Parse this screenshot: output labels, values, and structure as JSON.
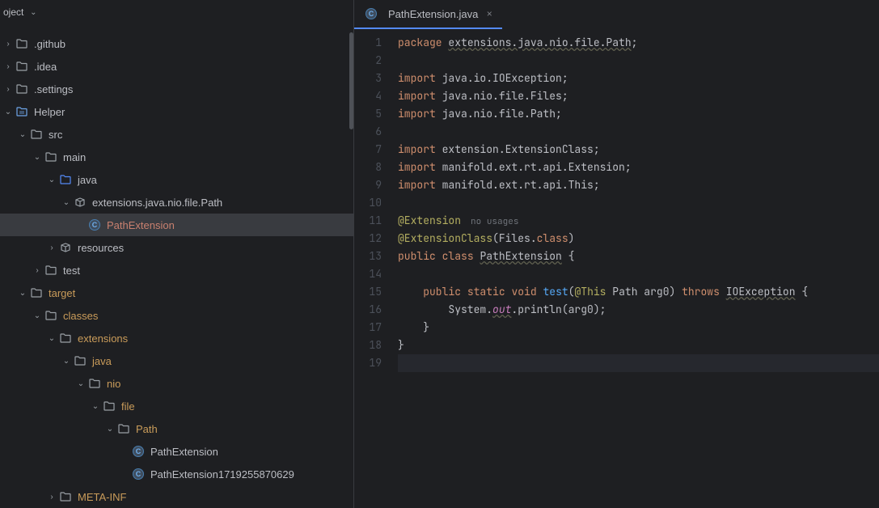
{
  "sidebar": {
    "header": "oject",
    "tree": [
      {
        "label": ".github",
        "depth": 0,
        "expanded": false,
        "icon": "folder",
        "arrow": true
      },
      {
        "label": ".idea",
        "depth": 0,
        "expanded": false,
        "icon": "folder",
        "arrow": true
      },
      {
        "label": ".settings",
        "depth": 0,
        "expanded": false,
        "icon": "folder",
        "arrow": true
      },
      {
        "label": "Helper",
        "depth": 0,
        "expanded": true,
        "icon": "module",
        "arrow": true
      },
      {
        "label": "src",
        "depth": 1,
        "expanded": true,
        "icon": "folder",
        "arrow": true
      },
      {
        "label": "main",
        "depth": 2,
        "expanded": true,
        "icon": "folder",
        "arrow": true
      },
      {
        "label": "java",
        "depth": 3,
        "expanded": true,
        "icon": "java-folder",
        "arrow": true
      },
      {
        "label": "extensions.java.nio.file.Path",
        "depth": 4,
        "expanded": true,
        "icon": "package",
        "arrow": true
      },
      {
        "label": "PathExtension",
        "depth": 5,
        "expanded": false,
        "icon": "class",
        "selected": true,
        "selectedFile": true,
        "arrow": false
      },
      {
        "label": "resources",
        "depth": 3,
        "expanded": false,
        "icon": "package",
        "arrow": true
      },
      {
        "label": "test",
        "depth": 2,
        "expanded": false,
        "icon": "folder",
        "arrow": true
      },
      {
        "label": "target",
        "depth": 1,
        "expanded": true,
        "icon": "target-folder",
        "arrow": true,
        "target": true
      },
      {
        "label": "classes",
        "depth": 2,
        "expanded": true,
        "icon": "target-folder",
        "arrow": true,
        "target": true
      },
      {
        "label": "extensions",
        "depth": 3,
        "expanded": true,
        "icon": "target-folder",
        "arrow": true,
        "target": true
      },
      {
        "label": "java",
        "depth": 4,
        "expanded": true,
        "icon": "target-folder",
        "arrow": true,
        "target": true
      },
      {
        "label": "nio",
        "depth": 5,
        "expanded": true,
        "icon": "target-folder",
        "arrow": true,
        "target": true
      },
      {
        "label": "file",
        "depth": 6,
        "expanded": true,
        "icon": "target-folder",
        "arrow": true,
        "target": true
      },
      {
        "label": "Path",
        "depth": 7,
        "expanded": true,
        "icon": "target-folder",
        "arrow": true,
        "target": true
      },
      {
        "label": "PathExtension",
        "depth": 8,
        "expanded": false,
        "icon": "class",
        "arrow": false
      },
      {
        "label": "PathExtension1719255870629",
        "depth": 8,
        "expanded": false,
        "icon": "class",
        "arrow": false
      },
      {
        "label": "META-INF",
        "depth": 3,
        "expanded": false,
        "icon": "target-folder",
        "arrow": true,
        "target": true
      }
    ]
  },
  "tabs": {
    "active": "PathExtension.java"
  },
  "code": {
    "hint": "no usages",
    "lines": [
      {
        "n": 1,
        "html": "<span class='kw'>package</span> <span class='pkg underline'>extensions.java.nio.file.Path</span>;"
      },
      {
        "n": 2,
        "html": ""
      },
      {
        "n": 3,
        "html": "<span class='kw'>import</span> java.io.IOException;"
      },
      {
        "n": 4,
        "html": "<span class='kw'>import</span> java.nio.file.Files;"
      },
      {
        "n": 5,
        "html": "<span class='kw'>import</span> java.nio.file.Path;"
      },
      {
        "n": 6,
        "html": ""
      },
      {
        "n": 7,
        "html": "<span class='kw'>import</span> extension.ExtensionClass;"
      },
      {
        "n": 8,
        "html": "<span class='kw'>import</span> manifold.ext.rt.api.Extension;"
      },
      {
        "n": 9,
        "html": "<span class='kw'>import</span> manifold.ext.rt.api.This;"
      },
      {
        "n": 10,
        "html": ""
      },
      {
        "n": 11,
        "html": "<span class='ann'>@Extension</span><span class='hint'>no usages</span>"
      },
      {
        "n": 12,
        "html": "<span class='ann'>@ExtensionClass</span>(Files.<span class='kw'>class</span>)"
      },
      {
        "n": 13,
        "html": "<span class='kw'>public</span> <span class='kw'>class</span> <span class='classname-def underline'>PathExtension</span> {"
      },
      {
        "n": 14,
        "html": ""
      },
      {
        "n": 15,
        "html": "    <span class='kw'>public</span> <span class='kw'>static</span> <span class='kw'>void</span> <span class='method'>test</span>(<span class='ann'>@This</span> Path arg0) <span class='kw'>throws</span> <span class='underline'>IOException</span> {"
      },
      {
        "n": 16,
        "html": "        System.<span class='field-italic underline'>out</span>.println(arg0);"
      },
      {
        "n": 17,
        "html": "    }"
      },
      {
        "n": 18,
        "html": "}"
      },
      {
        "n": 19,
        "html": "",
        "current": true
      }
    ]
  }
}
